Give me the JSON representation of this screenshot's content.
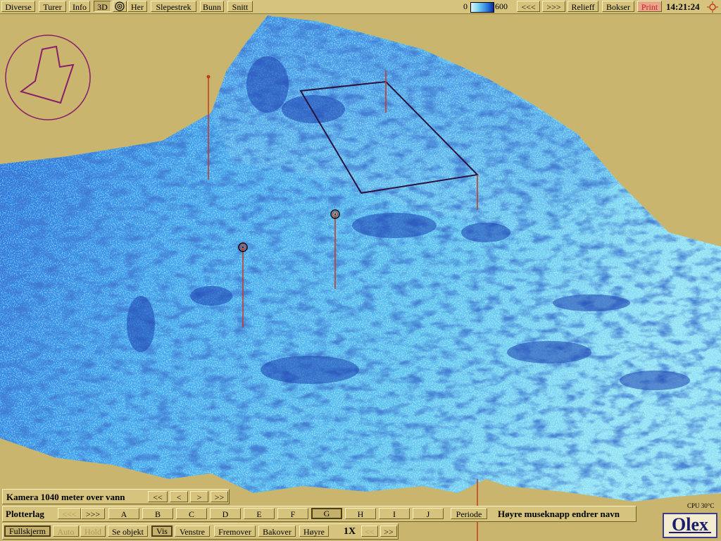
{
  "topbar": {
    "diverse": "Diverse",
    "turer": "Turer",
    "info": "Info",
    "mode_3d": "3D",
    "her": "Her",
    "slepestrek": "Slepestrek",
    "bunn": "Bunn",
    "snitt": "Snitt",
    "scale_min": "0",
    "scale_max": "600",
    "prev": "<<<",
    "next": ">>>",
    "relieff": "Relieff",
    "bokser": "Bokser",
    "print": "Print",
    "time": "14:21:24"
  },
  "camera_panel": {
    "label": "Kamera 1040 meter over vann",
    "btn_fast_back": "<<",
    "btn_back": "<",
    "btn_fwd": ">",
    "btn_fast_fwd": ">>"
  },
  "plotter_panel": {
    "label": "Plotterlag",
    "prev": "<<<",
    "next": ">>>",
    "layers": [
      "A",
      "B",
      "C",
      "D",
      "E",
      "F",
      "G",
      "H",
      "I",
      "J"
    ],
    "active_layer": "G",
    "periode": "Periode",
    "hint": "Høyre museknapp endrer navn"
  },
  "view_panel": {
    "fullskjerm": "Fullskjerm",
    "auto": "Auto",
    "hold": "Hold",
    "se_objekt": "Se objekt",
    "vis": "Vis",
    "venstre": "Venstre",
    "fremover": "Fremover",
    "bakover": "Bakover",
    "hoyre": "Høyre",
    "zoom": "1X",
    "prev": "<<",
    "next": ">>"
  },
  "cpu_label": "CPU 30°C",
  "logo": "Olex",
  "colors": {
    "background": "#c9b56e",
    "toolbar": "#d6c47e",
    "seabed_light": "#9ee6f2",
    "seabed_dark": "#1a3fae",
    "marker": "#c23a1e",
    "compass": "#8a1e6a"
  }
}
